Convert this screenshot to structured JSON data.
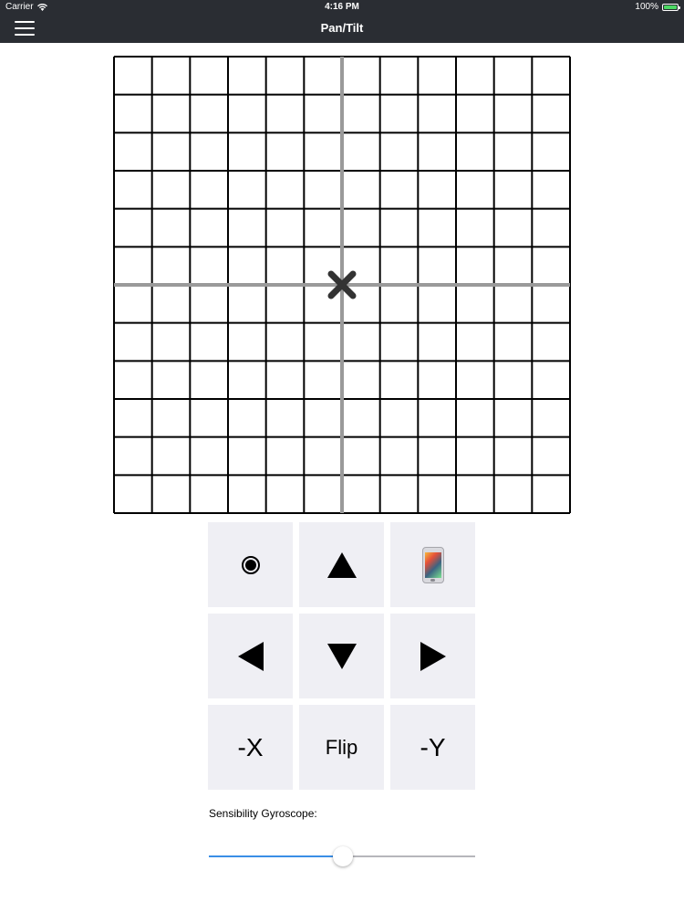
{
  "status_bar": {
    "carrier": "Carrier",
    "time": "4:16 PM",
    "battery": "100%"
  },
  "nav": {
    "title": "Pan/Tilt",
    "menu_icon": "hamburger-icon"
  },
  "grid": {
    "columns": 12,
    "rows": 12,
    "axis_color": "#9a9a9a",
    "line_color": "#000000",
    "marker_icon": "cross-icon",
    "marker_color": "#333333"
  },
  "controls": {
    "button_bg": "#efeff4",
    "buttons": [
      {
        "name": "record-button",
        "icon": "record-icon"
      },
      {
        "name": "up-button",
        "icon": "arrow-up-icon"
      },
      {
        "name": "phone-button",
        "icon": "phone-icon"
      },
      {
        "name": "left-button",
        "icon": "arrow-left-icon"
      },
      {
        "name": "down-button",
        "icon": "arrow-down-icon"
      },
      {
        "name": "right-button",
        "icon": "arrow-right-icon"
      },
      {
        "name": "invert-x-button",
        "label": "-X"
      },
      {
        "name": "flip-button",
        "label": "Flip"
      },
      {
        "name": "invert-y-button",
        "label": "-Y"
      }
    ]
  },
  "gyroscope": {
    "label": "Sensibility Gyroscope:",
    "value": 0.5,
    "accent_color": "#3a8ee6"
  }
}
